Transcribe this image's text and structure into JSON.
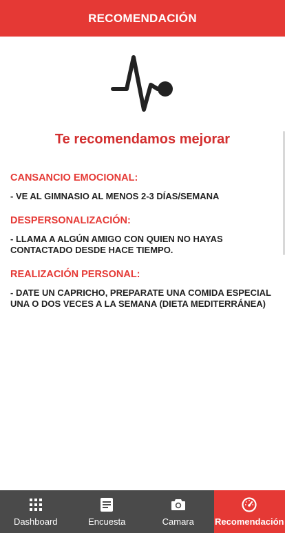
{
  "header": {
    "title": "RECOMENDACIÓN"
  },
  "hero": {
    "icon": "heartbeat-icon",
    "title": "Te recomendamos mejorar"
  },
  "sections": [
    {
      "heading": "CANSANCIO EMOCIONAL:",
      "text": "- VE AL GIMNASIO AL MENOS 2-3 DÍAS/SEMANA"
    },
    {
      "heading": "DESPERSONALIZACIÓN:",
      "text": "- LLAMA A ALGÚN AMIGO CON QUIEN NO HAYAS CONTACTADO DESDE HACE TIEMPO."
    },
    {
      "heading": "REALIZACIÓN PERSONAL:",
      "text": "- DATE UN CAPRICHO, PREPARATE UNA COMIDA ESPECIAL UNA O DOS VECES A LA SEMANA (DIETA MEDITERRÁNEA)"
    }
  ],
  "bottom_nav": {
    "items": [
      {
        "label": "Dashboard",
        "icon": "grid-icon",
        "active": false
      },
      {
        "label": "Encuesta",
        "icon": "form-icon",
        "active": false
      },
      {
        "label": "Camara",
        "icon": "camera-icon",
        "active": false
      },
      {
        "label": "Recomendación",
        "icon": "speedometer-icon",
        "active": true
      }
    ]
  },
  "colors": {
    "accent": "#e53935",
    "nav_background": "#4a4a4a"
  }
}
